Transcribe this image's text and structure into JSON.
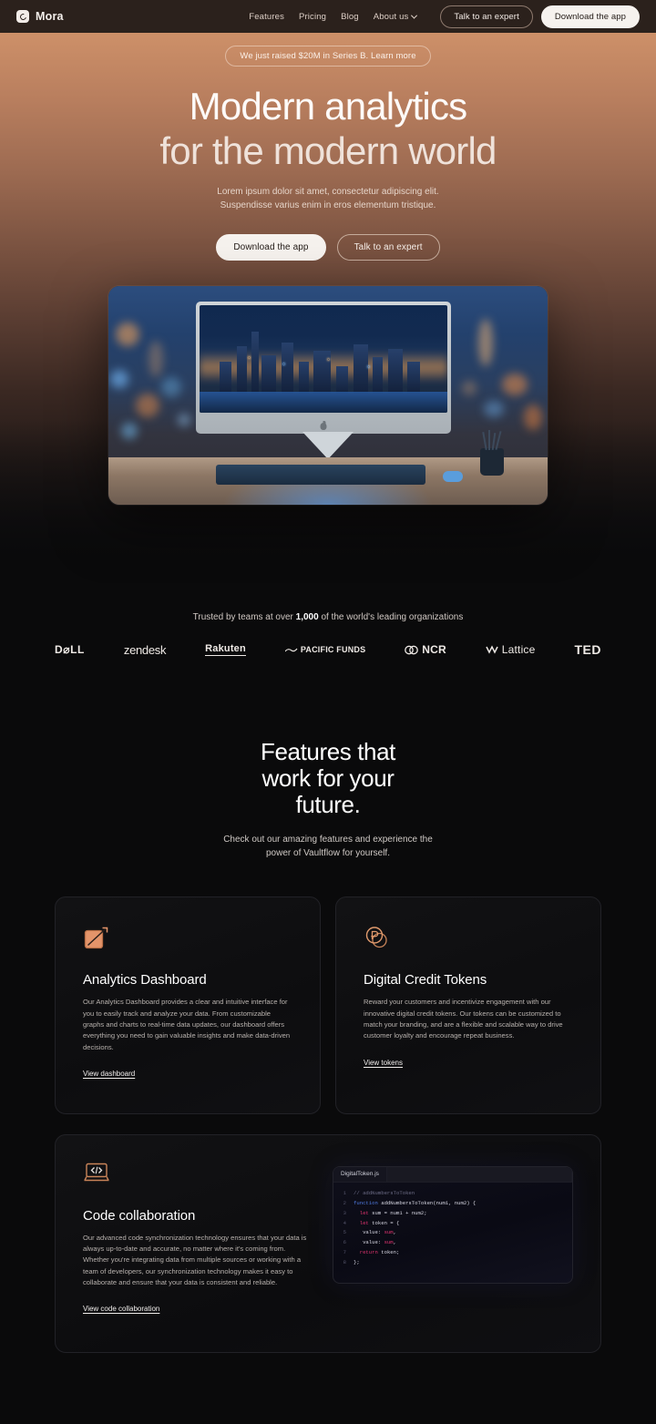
{
  "nav": {
    "brand": "Mora",
    "brand_icon": "mora-logo-icon",
    "links": [
      {
        "label": "Features",
        "icon": null
      },
      {
        "label": "Pricing",
        "icon": null
      },
      {
        "label": "Blog",
        "icon": null
      },
      {
        "label": "About us",
        "icon": "chevron-down-icon"
      }
    ],
    "cta_secondary": "Talk to an expert",
    "cta_primary": "Download the app"
  },
  "hero": {
    "badge": "We just raised $20M in Series B. Learn more",
    "title_line1": "Modern analytics",
    "title_line2": "for the modern world",
    "subtitle_line1": "Lorem ipsum dolor sit amet, consectetur adipiscing elit.",
    "subtitle_line2": "Suspendisse varius enim in eros elementum tristique.",
    "btn_primary": "Download the app",
    "btn_secondary": "Talk to an expert",
    "image_alt": "desk with imac displaying night cityscape"
  },
  "trusted": {
    "prefix": "Trusted by teams at over ",
    "count": "1,000",
    "suffix": " of the world's leading organizations",
    "logos": [
      {
        "name": "Dell",
        "text": "D⌀LL"
      },
      {
        "name": "Zendesk",
        "text": "zendesk"
      },
      {
        "name": "Rakuten",
        "text": "Rakuten"
      },
      {
        "name": "Pacific Funds",
        "text": "PACIFIC FUNDS"
      },
      {
        "name": "NCR",
        "text": "NCR"
      },
      {
        "name": "Lattice",
        "text": "Lattice"
      },
      {
        "name": "TED",
        "text": "TED"
      }
    ]
  },
  "features": {
    "title_line1": "Features that",
    "title_line2": "work for your",
    "title_line3": "future.",
    "subtitle_line1": "Check out our amazing features and experience the",
    "subtitle_line2": "power of Vaultflow for yourself.",
    "cards": [
      {
        "icon": "analytics-chart-icon",
        "title": "Analytics Dashboard",
        "body": "Our Analytics Dashboard provides a clear and intuitive interface for you to easily track and analyze your data. From customizable graphs and charts to real-time data updates, our dashboard offers everything you need to gain valuable insights and make data-driven decisions.",
        "link": "View dashboard"
      },
      {
        "icon": "coins-token-icon",
        "title": "Digital Credit Tokens",
        "body": "Reward your customers and incentivize engagement with our innovative digital credit tokens. Our tokens can be customized to match your branding, and are a flexible and scalable way to drive customer loyalty and encourage repeat business.",
        "link": "View tokens"
      }
    ],
    "wide_card": {
      "icon": "laptop-code-icon",
      "title": "Code collaboration",
      "body": "Our advanced code synchronization technology ensures that your data is always up-to-date and accurate, no matter where it's coming from. Whether you're integrating data from multiple sources or working with a team of developers, our synchronization technology makes it easy to collaborate and ensure that your data is consistent and reliable.",
      "link": "View code collaboration",
      "editor": {
        "tab": "DigitalToken.js",
        "lines": [
          {
            "no": "1",
            "code": "// addNumbersToToken"
          },
          {
            "no": "2",
            "code": "function addNumbersToToken(num1, num2) {"
          },
          {
            "no": "3",
            "code": "  let sum = num1 + num2;"
          },
          {
            "no": "4",
            "code": "  let token = {"
          },
          {
            "no": "5",
            "code": "   value: sum,"
          },
          {
            "no": "6",
            "code": "   value: sum,"
          },
          {
            "no": "7",
            "code": "  return token;"
          },
          {
            "no": "8",
            "code": "};"
          }
        ]
      }
    }
  },
  "colors": {
    "hero_gradient_top": "#d79a72",
    "page_background": "#0a0a0b",
    "nav_background": "#2b211c",
    "accent_icon": "#d9916a",
    "card_border": "#222227",
    "code_keyword": "#4f7ae0",
    "code_let": "#e0336f",
    "code_comment": "#6c6c86"
  }
}
